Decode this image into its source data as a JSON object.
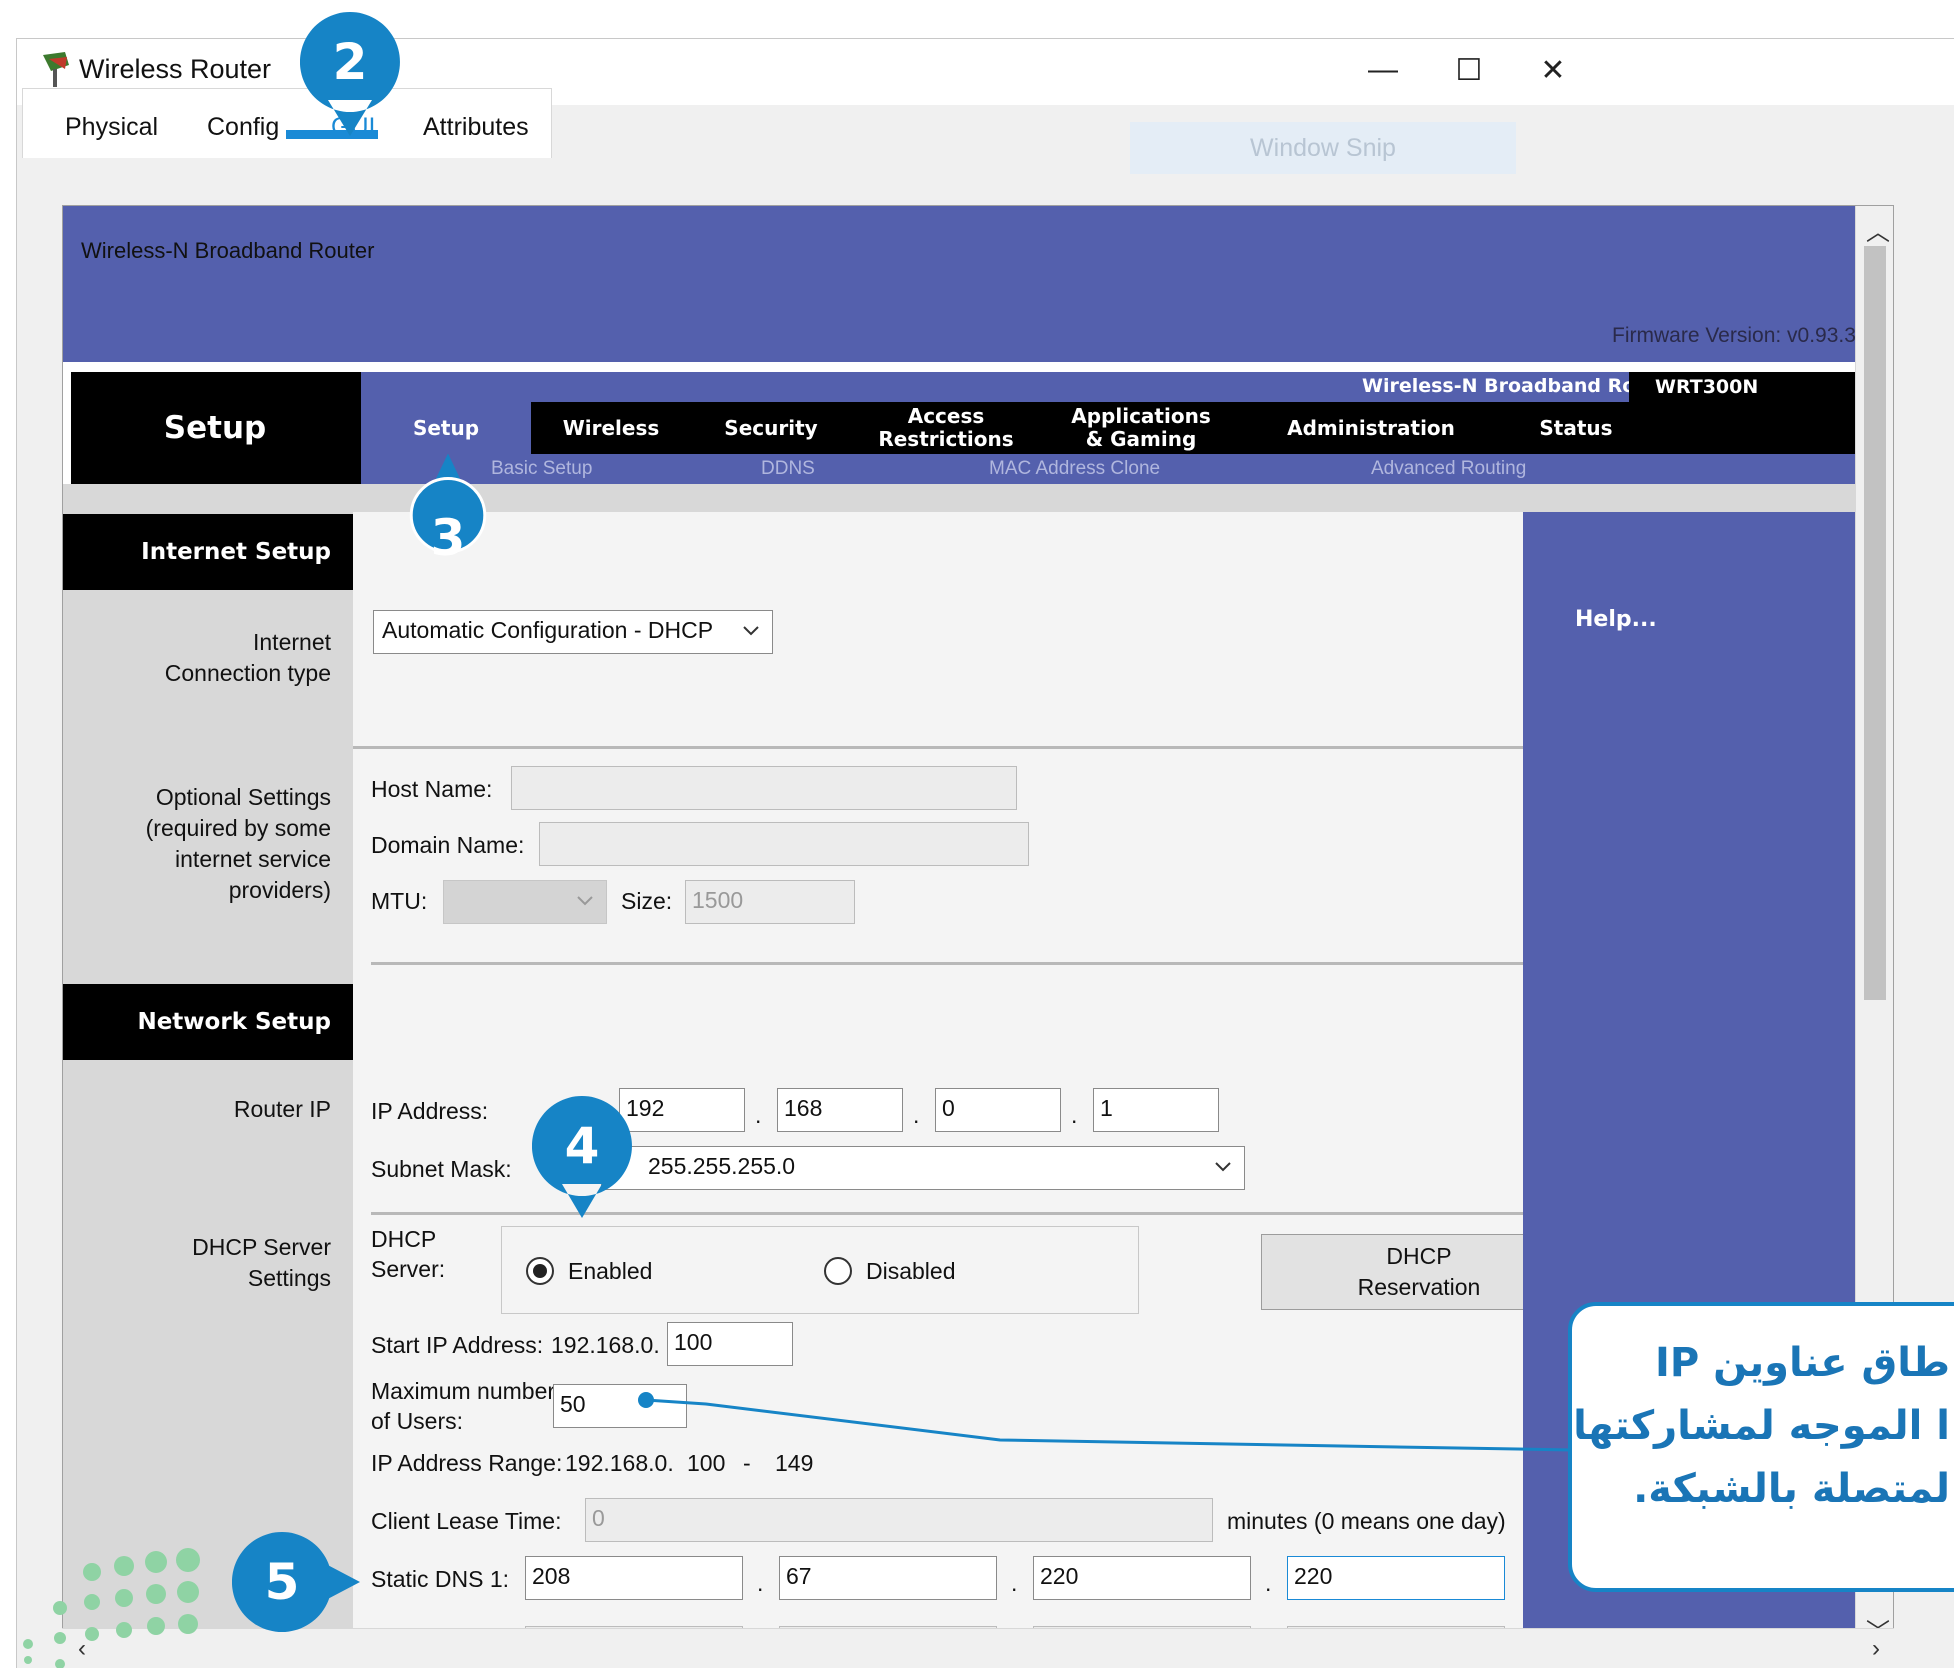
{
  "window": {
    "title": "Wireless Router",
    "controls": {
      "minimize": "—",
      "maximize": "☐",
      "close": "✕"
    }
  },
  "tabs": {
    "physical": "Physical",
    "config": "Config",
    "gui": "GUI",
    "attributes": "Attributes"
  },
  "overlay": {
    "snip": "Window Snip"
  },
  "router_page": {
    "banner_title": "Wireless-N Broadband Router",
    "firmware": "Firmware Version: v0.93.3",
    "section_label": "Setup",
    "model_name": "Wireless-N Broadband Router",
    "model_code": "WRT300N",
    "nav": {
      "setup": "Setup",
      "wireless": "Wireless",
      "security": "Security",
      "access_line1": "Access",
      "access_line2": "Restrictions",
      "apps_line1": "Applications",
      "apps_line2": "& Gaming",
      "administration": "Administration",
      "status": "Status"
    },
    "subnav": {
      "basic_setup": "Basic Setup",
      "ddns": "DDNS",
      "mac_clone": "MAC Address Clone",
      "advanced_routing": "Advanced Routing"
    },
    "left": {
      "internet_setup": "Internet Setup",
      "connection_type_line1": "Internet",
      "connection_type_line2": "Connection type",
      "optional_line1": "Optional Settings",
      "optional_line2": "(required by some",
      "optional_line3": "internet service",
      "optional_line4": "providers)",
      "network_setup": "Network Setup",
      "router_ip": "Router IP",
      "dhcp_settings_line1": "DHCP Server",
      "dhcp_settings_line2": "Settings"
    },
    "form": {
      "connection_type_value": "Automatic Configuration - DHCP",
      "host_name_label": "Host Name:",
      "host_name_value": "",
      "domain_name_label": "Domain Name:",
      "domain_name_value": "",
      "mtu_label": "MTU:",
      "mtu_value": "",
      "size_label": "Size:",
      "size_value": "1500",
      "ip_address_label": "IP Address:",
      "ip": [
        "192",
        "168",
        "0",
        "1"
      ],
      "subnet_mask_label": "Subnet Mask:",
      "subnet_mask_value": "255.255.255.0",
      "dhcp_server_line1": "DHCP",
      "dhcp_server_line2": "Server:",
      "dhcp_enabled": "Enabled",
      "dhcp_disabled": "Disabled",
      "dhcp_reservation_line1": "DHCP",
      "dhcp_reservation_line2": "Reservation",
      "start_ip_label": "Start IP Address:",
      "start_ip_prefix": "192.168.0.",
      "start_ip_value": "100",
      "max_users_line1": "Maximum number",
      "max_users_line2": "of Users:",
      "max_users_value": "50",
      "ip_range_label": "IP Address Range:",
      "ip_range_prefix": "192.168.0.",
      "ip_range_start": "100",
      "ip_range_dash": "-",
      "ip_range_end": "149",
      "lease_label": "Client Lease Time:",
      "lease_value": "0",
      "lease_note": "minutes (0 means one day)",
      "static_dns_label": "Static DNS 1:",
      "dns": [
        "208",
        "67",
        "220",
        "220"
      ]
    },
    "help": "Help..."
  },
  "steps": {
    "step2": "2",
    "step3": "3",
    "step4": "4",
    "step5": "5"
  },
  "callout": {
    "line1": "طاق عناوين IP",
    "line2": "ا الموجه لمشاركتها",
    "line3": "لمتصلة بالشبكة."
  },
  "colors": {
    "router_purple": "#5460ad",
    "badge_blue": "#1684c6",
    "tab_underline": "#1a8ad6"
  }
}
